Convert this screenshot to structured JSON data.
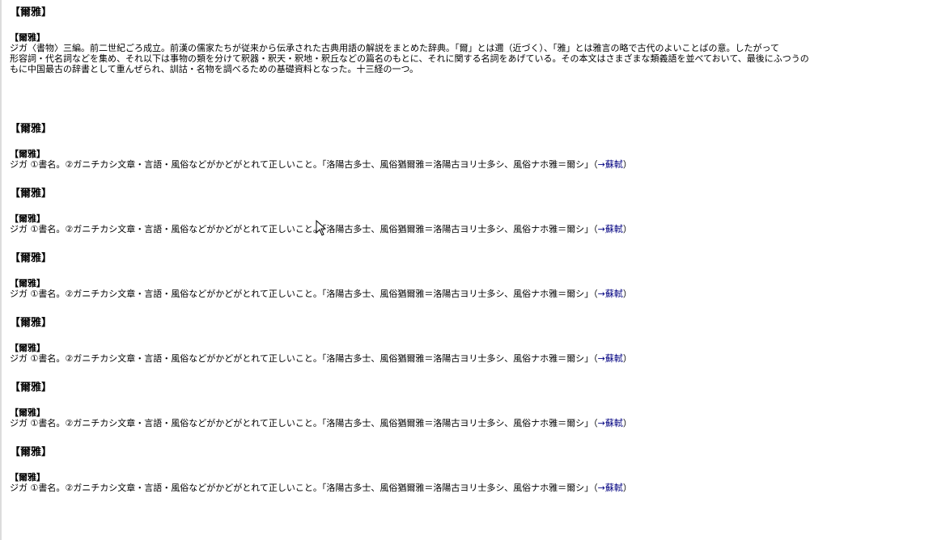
{
  "first_entry": {
    "title": "【爾雅】",
    "head": "【爾雅】",
    "lines": [
      "ジガ〈書物〉三編。前二世紀ごろ成立。前漢の儒家たちが従来から伝承された古典用語の解説をまとめた辞典。「爾」とは邇（近づく）、「雅」とは雅言の略で古代のよいことばの意。したがって",
      "形容詞・代名詞などを集め、それ以下は事物の類を分けて釈器・釈天・釈地・釈丘などの篇名のもとに、それに関する名詞をあげている。その本文はさまざまな類義語を並べておいて、最後にふつうの",
      "もに中国最古の辞書として重んぜられ、訓詁・名物を調べるための基礎資料となった。十三経の一つ。"
    ]
  },
  "repeat_entries": [
    {
      "title": "【爾雅】",
      "head": "【爾雅】",
      "body": "ジガ ①書名。②ガニチカシ文章・言語・風俗などがかどがとれて正しいこと。「洛陽古多士、風俗猶爾雅＝洛陽古ヨリ士多シ、風俗ナホ雅＝爾シ」（",
      "xref": "→蘇軾",
      "close": "）"
    },
    {
      "title": "【爾雅】",
      "head": "【爾雅】",
      "body": "ジガ ①書名。②ガニチカシ文章・言語・風俗などがかどがとれて正しいこと。「洛陽古多士、風俗猶爾雅＝洛陽古ヨリ士多シ、風俗ナホ雅＝爾シ」（",
      "xref": "→蘇軾",
      "close": "）"
    },
    {
      "title": "【爾雅】",
      "head": "【爾雅】",
      "body": "ジガ ①書名。②ガニチカシ文章・言語・風俗などがかどがとれて正しいこと。「洛陽古多士、風俗猶爾雅＝洛陽古ヨリ士多シ、風俗ナホ雅＝爾シ」（",
      "xref": "→蘇軾",
      "close": "）"
    },
    {
      "title": "【爾雅】",
      "head": "【爾雅】",
      "body": "ジガ ①書名。②ガニチカシ文章・言語・風俗などがかどがとれて正しいこと。「洛陽古多士、風俗猶爾雅＝洛陽古ヨリ士多シ、風俗ナホ雅＝爾シ」（",
      "xref": "→蘇軾",
      "close": "）"
    },
    {
      "title": "【爾雅】",
      "head": "【爾雅】",
      "body": "ジガ ①書名。②ガニチカシ文章・言語・風俗などがかどがとれて正しいこと。「洛陽古多士、風俗猶爾雅＝洛陽古ヨリ士多シ、風俗ナホ雅＝爾シ」（",
      "xref": "→蘇軾",
      "close": "）"
    },
    {
      "title": "【爾雅】",
      "head": "【爾雅】",
      "body": "ジガ ①書名。②ガニチカシ文章・言語・風俗などがかどがとれて正しいこと。「洛陽古多士、風俗猶爾雅＝洛陽古ヨリ士多シ、風俗ナホ雅＝爾シ」（",
      "xref": "→蘇軾",
      "close": "）"
    }
  ]
}
